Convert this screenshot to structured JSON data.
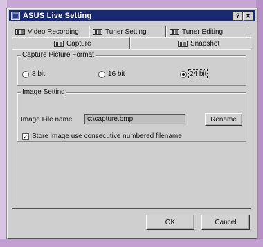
{
  "window": {
    "title": "ASUS Live Setting"
  },
  "tabs": {
    "row1": [
      {
        "label": "Video Recording"
      },
      {
        "label": "Tuner Setting"
      },
      {
        "label": "Tuner Editing"
      }
    ],
    "row2": [
      {
        "label": "Capture"
      },
      {
        "label": "Snapshot"
      }
    ],
    "selected": "Snapshot"
  },
  "capture_format": {
    "title": "Capture Picture Format",
    "options": [
      {
        "label": "8 bit",
        "checked": false
      },
      {
        "label": "16 bit",
        "checked": false
      },
      {
        "label": "24 bit",
        "checked": true
      }
    ]
  },
  "image_setting": {
    "title": "Image Setting",
    "file_label": "Image File name",
    "file_value": "c:\\capture.bmp",
    "rename_button": "Rename",
    "checkbox_label": "Store image use consecutive numbered filename",
    "checkbox_checked": true
  },
  "footer": {
    "ok_button": "OK",
    "cancel_button": "Cancel"
  }
}
